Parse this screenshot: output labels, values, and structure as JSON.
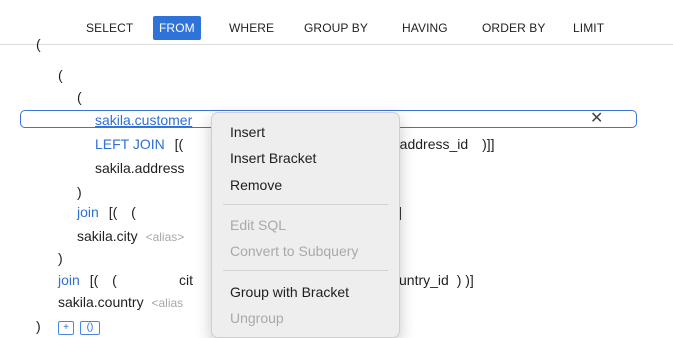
{
  "tabs": [
    {
      "label": "SELECT"
    },
    {
      "label": "FROM",
      "active": true
    },
    {
      "label": "WHERE"
    },
    {
      "label": "GROUP BY"
    },
    {
      "label": "HAVING"
    },
    {
      "label": "ORDER BY"
    },
    {
      "label": "LIMIT"
    }
  ],
  "code": {
    "paren_open": "(",
    "paren_close": ")",
    "table_customer": "sakila.customer",
    "left_join": "LEFT JOIN",
    "join_bracket": "[(",
    "cond_address": "a.address_id",
    "cond_address_close": ")]]",
    "table_address": "sakila.address",
    "join": "join",
    "join_inner": "[(",
    "join_inner_paren": "(",
    "table_city": "sakila.city",
    "alias_placeholder": "<alias>",
    "alias_truncated": "<alias",
    "city_partial": "cit",
    "cond_country": "untry_id",
    "cond_country_close": ") )]",
    "bracket_close": "]",
    "table_country": "sakila.country",
    "add_button": "+",
    "bracket_button": "()",
    "close_icon_glyph": "✕"
  },
  "menu": {
    "insert": "Insert",
    "insert_bracket": "Insert Bracket",
    "remove": "Remove",
    "edit_sql": "Edit SQL",
    "convert_subquery": "Convert to Subquery",
    "group_bracket": "Group with Bracket",
    "ungroup": "Ungroup"
  },
  "colors": {
    "accent": "#2f73d9",
    "keyword": "#2f6fd6",
    "muted": "#a8a8a8"
  }
}
